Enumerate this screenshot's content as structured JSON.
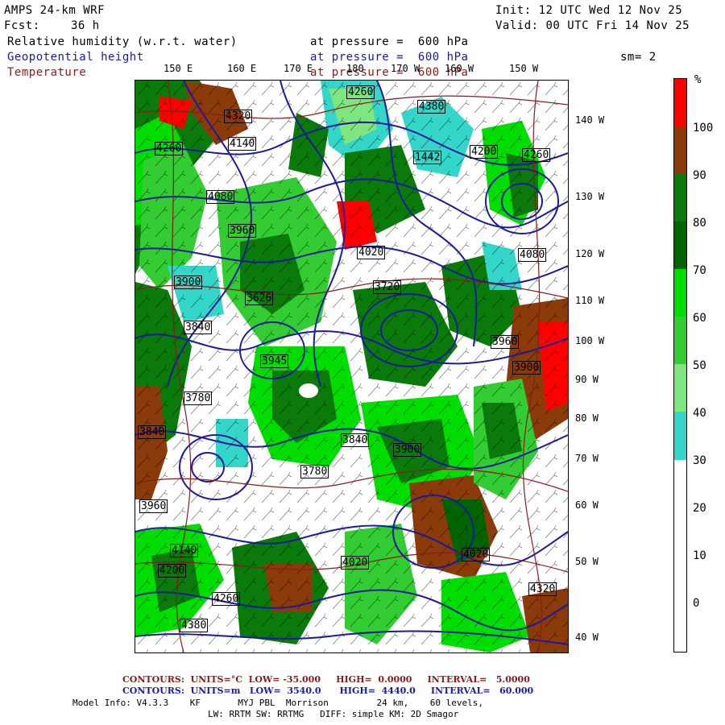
{
  "header": {
    "model": "AMPS 24-km WRF",
    "init": "Init: 12 UTC Wed 12 Nov 25",
    "fcst_label": "Fcst:",
    "fcst_value": "36 h",
    "valid": "Valid: 00 UTC Fri 14 Nov 25"
  },
  "fields": [
    {
      "name": "Relative humidity (w.r.t. water)",
      "level": "at pressure =  600 hPa",
      "color": "#000000"
    },
    {
      "name": "Geopotential height",
      "level": "at pressure =  600 hPa",
      "color": "#1a1aa0"
    },
    {
      "name": "Temperature",
      "level": "at pressure =  600 hPa",
      "color": "#8b1a1a"
    }
  ],
  "smoothing": "sm= 2",
  "lon_labels_top": [
    "150 E",
    "160 E",
    "170 E",
    "180",
    "170 W",
    "160 W",
    "150 W"
  ],
  "lat_labels_right": [
    "140 W",
    "130 W",
    "120 W",
    "110 W",
    "100 W",
    "90 W",
    "80 W",
    "70 W",
    "60 W",
    "50 W",
    "40 W"
  ],
  "height_labels": [
    "4260",
    "4320",
    "4380",
    "4260",
    "4200",
    "4140",
    "4080",
    "4020",
    "3960",
    "3900",
    "3840",
    "3780",
    "3720",
    "3960",
    "3945",
    "3626",
    "1442",
    "4140",
    "3960",
    "4020",
    "4080",
    "4200",
    "4260",
    "4320",
    "4380",
    "4260",
    "4020",
    "3900",
    "3840",
    "3780",
    "3840",
    "3900"
  ],
  "colorbar": {
    "unit": "%",
    "labels": [
      "100",
      "90",
      "80",
      "70",
      "60",
      "50",
      "40",
      "30",
      "20",
      "10",
      "0"
    ],
    "colors": [
      "#ff0000",
      "#8b3a0a",
      "#0a7a0a",
      "#006400",
      "#00dd00",
      "#33cc33",
      "#7fe57f",
      "#33d6c8",
      "#ffffff",
      "#ffffff",
      "#ffffff",
      "#ffffff"
    ]
  },
  "footer": {
    "rh_line": "CONTOURS:  UNITS=°C  LOW= -35.000     HIGH=  0.0000     INTERVAL=   5.0000",
    "hgt_line": "CONTOURS:  UNITS=m   LOW=  3540.0      HIGH=  4440.0     INTERVAL=   60.000",
    "model_info": "Model Info: V4.3.3    KF       MYJ PBL  Morrison         24 km,    60 levels,",
    "physics": "LW: RRTM SW: RRTMG   DIFF: simple KM: 2D Smagor"
  }
}
